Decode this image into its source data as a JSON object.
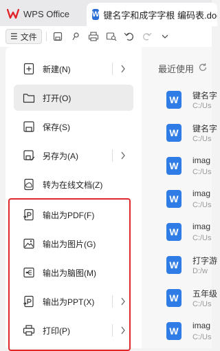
{
  "tabs": {
    "app_name": "WPS Office",
    "doc_badge": "W",
    "doc_title": "键名字和成字字根 编码表.doc"
  },
  "toolbar": {
    "menu_icon": "☰",
    "menu_label": "文件"
  },
  "file_menu": {
    "items": [
      {
        "label": "新建(N)",
        "icon": "new-doc-icon",
        "has_arrow": true
      },
      {
        "label": "打开(O)",
        "icon": "folder-icon",
        "has_arrow": false
      },
      {
        "label": "保存(S)",
        "icon": "save-icon",
        "has_arrow": false
      },
      {
        "label": "另存为(A)",
        "icon": "save-as-icon",
        "has_arrow": true
      },
      {
        "label": "转为在线文档(Z)",
        "icon": "cloud-doc-icon",
        "has_arrow": false
      },
      {
        "label": "输出为PDF(F)",
        "icon": "pdf-export-icon",
        "has_arrow": false
      },
      {
        "label": "输出为图片(G)",
        "icon": "image-export-icon",
        "has_arrow": false
      },
      {
        "label": "输出为脑图(M)",
        "icon": "mindmap-export-icon",
        "has_arrow": false
      },
      {
        "label": "输出为PPT(X)",
        "icon": "ppt-export-icon",
        "has_arrow": true
      },
      {
        "label": "打印(P)",
        "icon": "printer-icon",
        "has_arrow": true
      }
    ],
    "highlight_color": "#e0262a"
  },
  "recent": {
    "title": "最近使用",
    "files": [
      {
        "name": "键名字",
        "path": "C:/Us"
      },
      {
        "name": "键名字",
        "path": "C:/Us"
      },
      {
        "name": "imag",
        "path": "C:/Us"
      },
      {
        "name": "imag",
        "path": "C:/Us"
      },
      {
        "name": "imag",
        "path": "C:/Us"
      },
      {
        "name": "打字游",
        "path": "D:/w"
      },
      {
        "name": "五年级",
        "path": "C:/Us"
      },
      {
        "name": "imag",
        "path": "C:/Us"
      }
    ],
    "file_badge": "W"
  },
  "colors": {
    "accent_blue": "#2f7ce6",
    "wps_red": "#e0262a"
  }
}
